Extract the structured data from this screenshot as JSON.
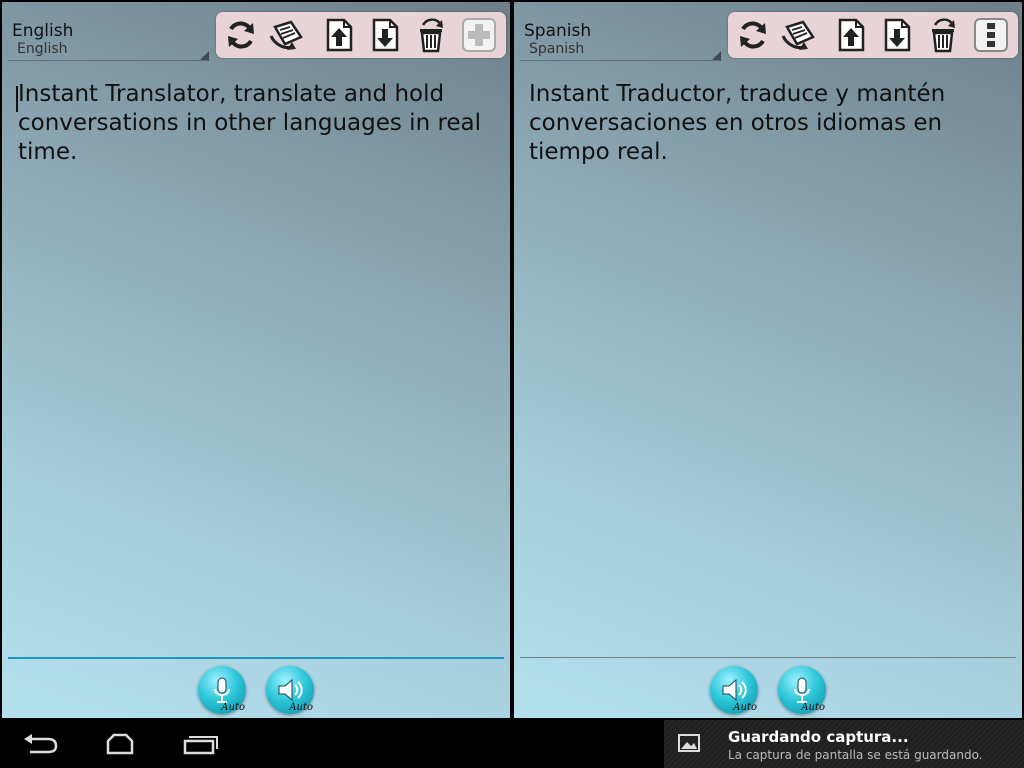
{
  "left_panel": {
    "language_title": "English",
    "language_subtitle": "English",
    "text": "Instant Translator, translate and hold conversations in other languages in real time.",
    "buttons": {
      "mic_auto": "Auto",
      "speaker_auto": "Auto"
    }
  },
  "right_panel": {
    "language_title": "Spanish",
    "language_subtitle": "Spanish",
    "text": "Instant Traductor, traduce y mantén conversaciones en otros idiomas en tiempo real.",
    "buttons": {
      "speaker_auto": "Auto",
      "mic_auto": "Auto"
    }
  },
  "notification": {
    "title": "Guardando captura...",
    "text": "La captura de pantalla se está guardando."
  },
  "colors": {
    "toolbar_bg": "#e8d4d6",
    "accent_underline": "#1f96bd",
    "round_button": "#2ec7da"
  },
  "icons": {
    "toolbar": [
      "refresh-icon",
      "translate-icon",
      "upload-icon",
      "download-icon",
      "recycle-bin-icon"
    ],
    "left_extra": "add-icon",
    "right_extra": "more-vertical-icon",
    "nav": [
      "back-icon",
      "home-icon",
      "recent-apps-icon"
    ]
  }
}
